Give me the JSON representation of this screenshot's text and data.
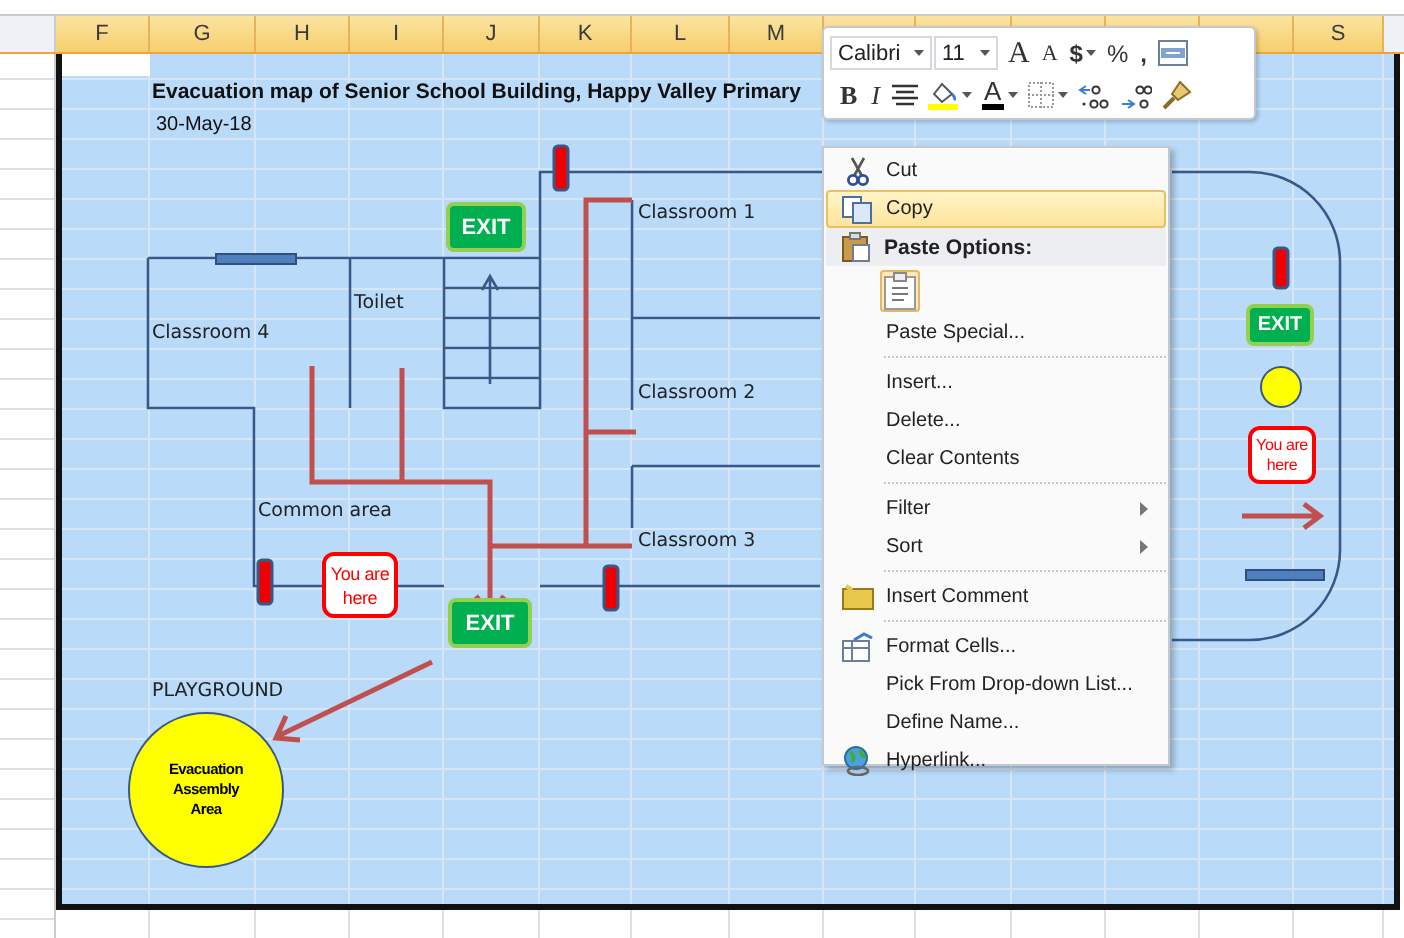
{
  "column_headers": [
    "F",
    "G",
    "H",
    "I",
    "J",
    "K",
    "L",
    "M"
  ],
  "last_column_header": "S",
  "map": {
    "title": "Evacuation map of Senior School Building, Happy Valley Primary",
    "date": "30-May-18",
    "room_labels": [
      "Classroom 1",
      "Classroom 2",
      "Classroom 3",
      "Toilet",
      "Classroom 4",
      "Common area",
      "PLAYGROUND"
    ],
    "exit_signs": [
      "EXIT",
      "EXIT"
    ],
    "you_are_here": "You are here",
    "assembly_area": "Evacuation Assembly Area"
  },
  "legend": [
    {
      "kind": "door"
    },
    {
      "kind": "exit",
      "text": "EXIT"
    },
    {
      "kind": "assembly"
    },
    {
      "kind": "you_are_here",
      "text": "You are here"
    },
    {
      "kind": "route"
    },
    {
      "kind": "window"
    }
  ],
  "mini_toolbar": {
    "font": "Calibri",
    "size": "11",
    "row1": [
      {
        "kind": "grow",
        "text": "A"
      },
      {
        "kind": "shrink",
        "text": "A"
      },
      {
        "kind": "currency",
        "text": "$"
      },
      {
        "kind": "percent",
        "text": "%"
      },
      {
        "kind": "comma",
        "text": ","
      },
      {
        "kind": "merge"
      }
    ],
    "row2": [
      {
        "kind": "bold",
        "text": "B"
      },
      {
        "kind": "italic",
        "text": "I"
      },
      {
        "kind": "center"
      },
      {
        "kind": "fill"
      },
      {
        "kind": "font_color",
        "text": "A"
      },
      {
        "kind": "borders"
      },
      {
        "kind": "inc_decimal"
      },
      {
        "kind": "dec_decimal"
      },
      {
        "kind": "painter"
      }
    ]
  },
  "context_menu": [
    {
      "kind": "item",
      "label": "Cut",
      "selected": false,
      "submenu": false
    },
    {
      "kind": "item",
      "label": "Copy",
      "selected": true,
      "submenu": false
    },
    {
      "kind": "header",
      "label": "Paste Options:"
    },
    {
      "kind": "paste"
    },
    {
      "kind": "item",
      "label": "Paste Special...",
      "selected": false,
      "submenu": false
    },
    {
      "kind": "separator"
    },
    {
      "kind": "item",
      "label": "Insert...",
      "selected": false,
      "submenu": false
    },
    {
      "kind": "item",
      "label": "Delete...",
      "selected": false,
      "submenu": false
    },
    {
      "kind": "item",
      "label": "Clear Contents",
      "selected": false,
      "submenu": false
    },
    {
      "kind": "separator"
    },
    {
      "kind": "item",
      "label": "Filter",
      "selected": false,
      "submenu": true
    },
    {
      "kind": "item",
      "label": "Sort",
      "selected": false,
      "submenu": true
    },
    {
      "kind": "separator"
    },
    {
      "kind": "item",
      "label": "Insert Comment",
      "selected": false,
      "submenu": false
    },
    {
      "kind": "separator"
    },
    {
      "kind": "item",
      "label": "Format Cells...",
      "selected": false,
      "submenu": false
    },
    {
      "kind": "item",
      "label": "Pick From Drop-down List...",
      "selected": false,
      "submenu": false
    },
    {
      "kind": "item",
      "label": "Define Name...",
      "selected": false,
      "submenu": false
    },
    {
      "kind": "item",
      "label": "Hyperlink...",
      "selected": false,
      "submenu": false
    }
  ]
}
